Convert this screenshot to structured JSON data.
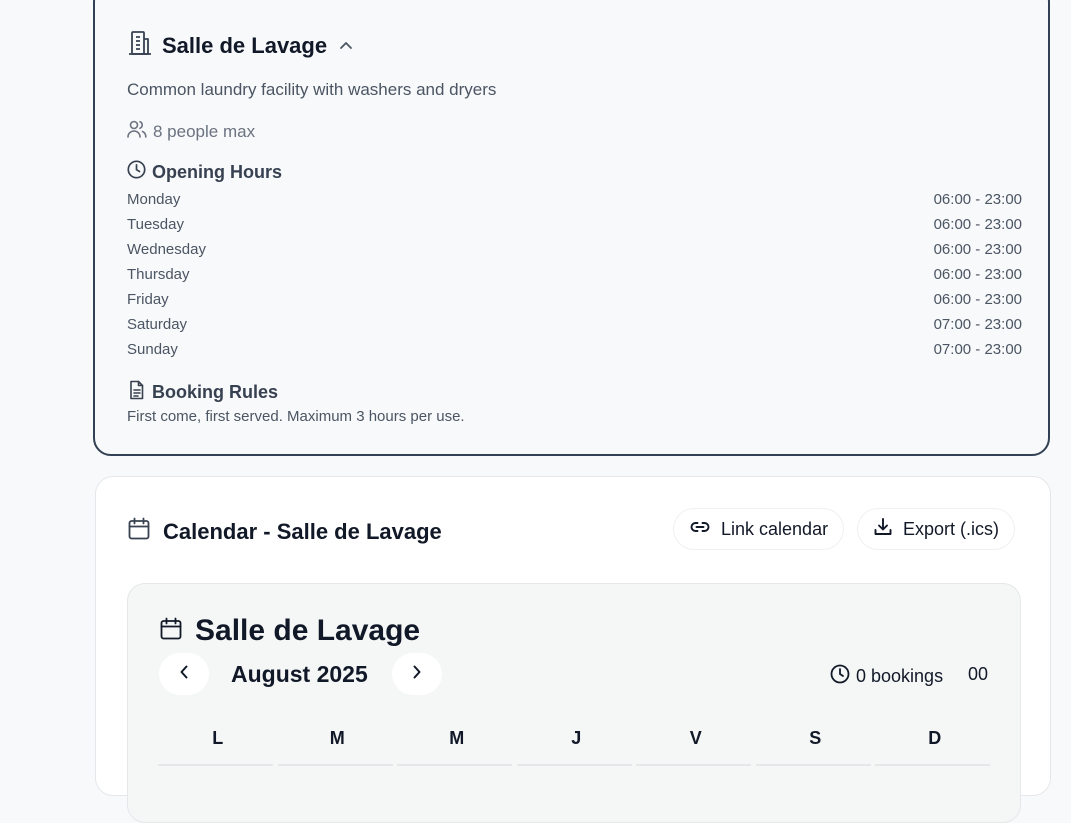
{
  "room": {
    "title": "Salle de Lavage",
    "description": "Common laundry facility with washers and dryers",
    "capacity": "8 people max",
    "opening_hours_title": "Opening Hours",
    "hours": [
      {
        "day": "Monday",
        "time": "06:00 - 23:00"
      },
      {
        "day": "Tuesday",
        "time": "06:00 - 23:00"
      },
      {
        "day": "Wednesday",
        "time": "06:00 - 23:00"
      },
      {
        "day": "Thursday",
        "time": "06:00 - 23:00"
      },
      {
        "day": "Friday",
        "time": "06:00 - 23:00"
      },
      {
        "day": "Saturday",
        "time": "07:00 - 23:00"
      },
      {
        "day": "Sunday",
        "time": "07:00 - 23:00"
      }
    ],
    "rules_title": "Booking Rules",
    "rules_text": "First come, first served. Maximum 3 hours per use."
  },
  "calendar_card": {
    "title": "Calendar - Salle de Lavage",
    "link_label": "Link calendar",
    "export_label": "Export (.ics)"
  },
  "calendar": {
    "title": "Salle de Lavage",
    "month": "August 2025",
    "bookings": "0 bookings",
    "time_readout": "00",
    "weekdays": [
      "L",
      "M",
      "M",
      "J",
      "V",
      "S",
      "D"
    ]
  },
  "icons": {
    "room": "building-icon",
    "collapse": "chevron-up-icon",
    "capacity": "users-icon",
    "hours": "clock-icon",
    "rules": "document-icon",
    "calendar": "calendar-icon",
    "link": "link-icon",
    "export": "download-icon",
    "prev": "chevron-left-icon",
    "next": "chevron-right-icon"
  }
}
